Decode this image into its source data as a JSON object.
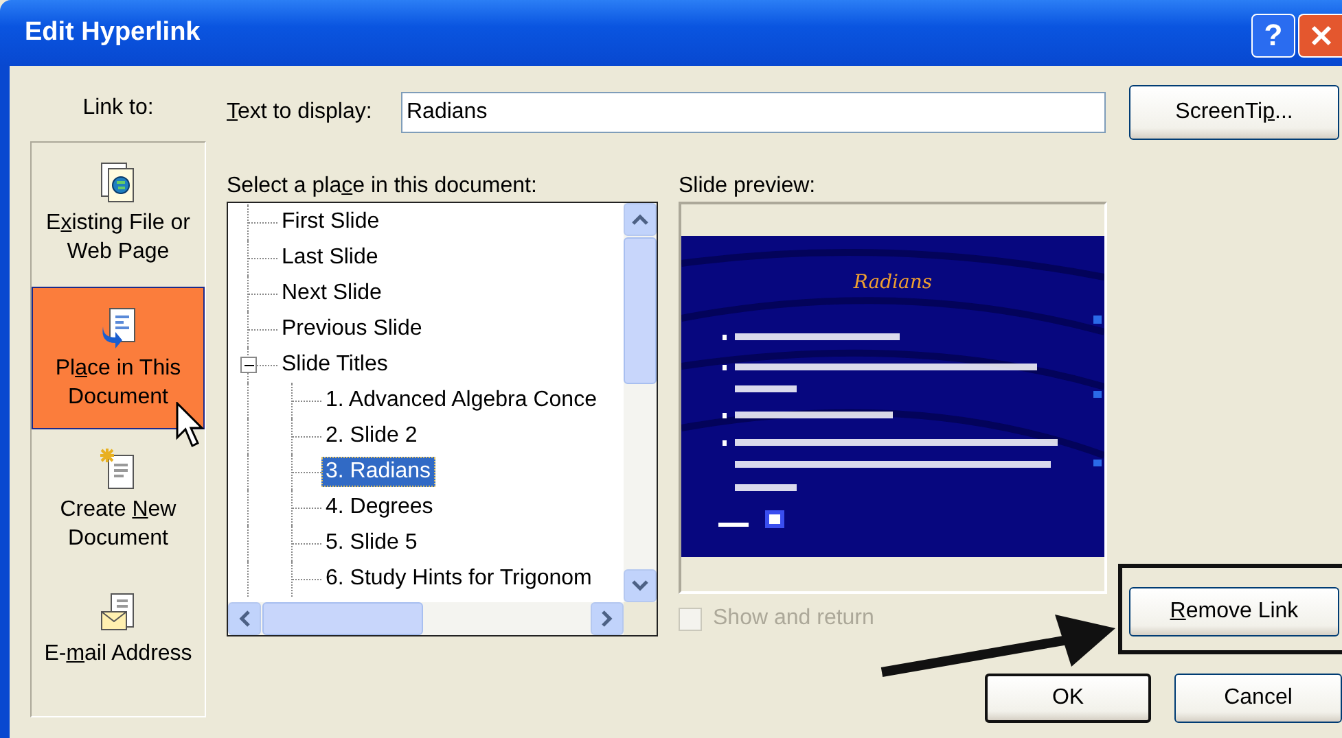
{
  "window": {
    "title": "Edit Hyperlink",
    "help_button": "?"
  },
  "link_to": {
    "label": "Link to:",
    "items": [
      {
        "label": {
          "before": "E",
          "key": "x",
          "after": "isting File or Web Page"
        },
        "kind": "file",
        "selected": false
      },
      {
        "label": {
          "before": "Pl",
          "key": "a",
          "after": "ce in This Document"
        },
        "kind": "place",
        "selected": true
      },
      {
        "label": {
          "before": "Create ",
          "key": "N",
          "after": "ew Document"
        },
        "kind": "new",
        "selected": false
      },
      {
        "label": {
          "before": "E-",
          "key": "m",
          "after": "ail Address"
        },
        "kind": "email",
        "selected": false
      }
    ]
  },
  "text_to_display": {
    "label": {
      "key": "T",
      "after": "ext to display:"
    },
    "value": "Radians"
  },
  "screentip_button": {
    "before": "ScreenTi",
    "key": "p",
    "after": "..."
  },
  "place_list": {
    "label": {
      "before": "Select a pla",
      "key": "c",
      "after": "e in this document:"
    },
    "items": [
      {
        "label": "First Slide",
        "selected": false
      },
      {
        "label": "Last Slide",
        "selected": false
      },
      {
        "label": "Next Slide",
        "selected": false
      },
      {
        "label": "Previous Slide",
        "selected": false
      },
      {
        "label": "Slide Titles",
        "selected": false,
        "expanded": true,
        "children": [
          {
            "label": "1. Advanced Algebra Conce",
            "selected": false
          },
          {
            "label": "2. Slide 2",
            "selected": false
          },
          {
            "label": "3. Radians",
            "selected": true
          },
          {
            "label": "4. Degrees",
            "selected": false
          },
          {
            "label": "5. Slide 5",
            "selected": false
          },
          {
            "label": "6. Study Hints for Trigonom",
            "selected": false
          }
        ]
      }
    ]
  },
  "preview": {
    "label": "Slide preview:",
    "slide_title": "Radians"
  },
  "show_and_return": {
    "label": "Show and return",
    "checked": false,
    "disabled": true
  },
  "remove_link_button": {
    "key": "R",
    "after": "emove Link"
  },
  "ok_button": "OK",
  "cancel_button": "Cancel"
}
